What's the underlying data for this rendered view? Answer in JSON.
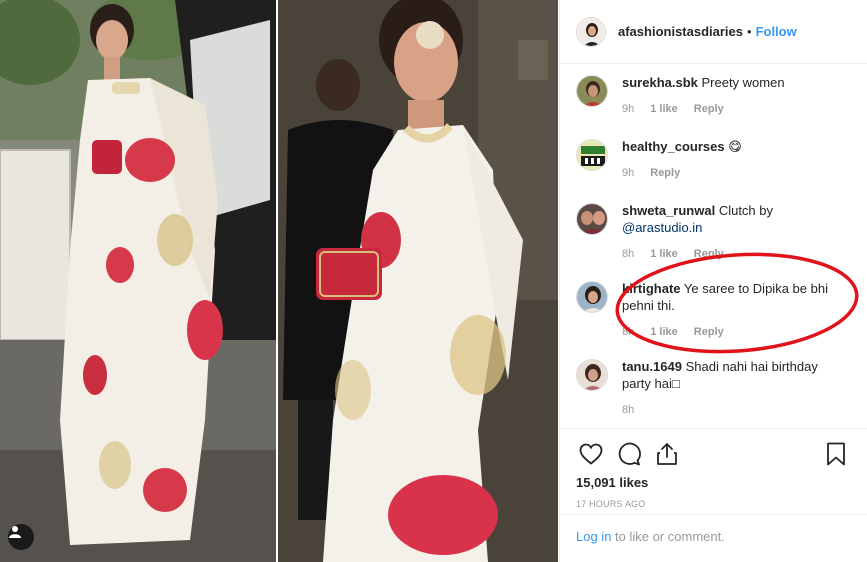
{
  "post": {
    "username": "afashionistasdiaries",
    "separator": "•",
    "follow_label": "Follow"
  },
  "comments": [
    {
      "user": "surekha.sbk",
      "text": " Preety women",
      "mention": "",
      "time": "9h",
      "likes": "1 like",
      "reply": "Reply"
    },
    {
      "user": "healthy_courses",
      "text": " 😋",
      "mention": "",
      "time": "9h",
      "likes": "",
      "reply": "Reply"
    },
    {
      "user": "shweta_runwal",
      "text": " Clutch by ",
      "mention": "@arastudio.in",
      "time": "8h",
      "likes": "1 like",
      "reply": "Reply"
    },
    {
      "user": "kirtighate",
      "text": " Ye saree to Dipika be bhi pehni thi.",
      "mention": "",
      "time": "8h",
      "likes": "1 like",
      "reply": "Reply"
    },
    {
      "user": "tanu.1649",
      "text": " Shadi nahi hai birthday party hai□",
      "mention": "",
      "time": "8h",
      "likes": "",
      "reply": ""
    }
  ],
  "actions": {
    "like_icon": "heart-icon",
    "comment_icon": "comment-icon",
    "share_icon": "share-icon",
    "save_icon": "bookmark-icon"
  },
  "likes_count": "15,091 likes",
  "timestamp": "17 HOURS AGO",
  "login": {
    "link_label": "Log in",
    "suffix": " to like or comment."
  },
  "colors": {
    "accent": "#3897f0",
    "annotation": "#e0131b"
  }
}
